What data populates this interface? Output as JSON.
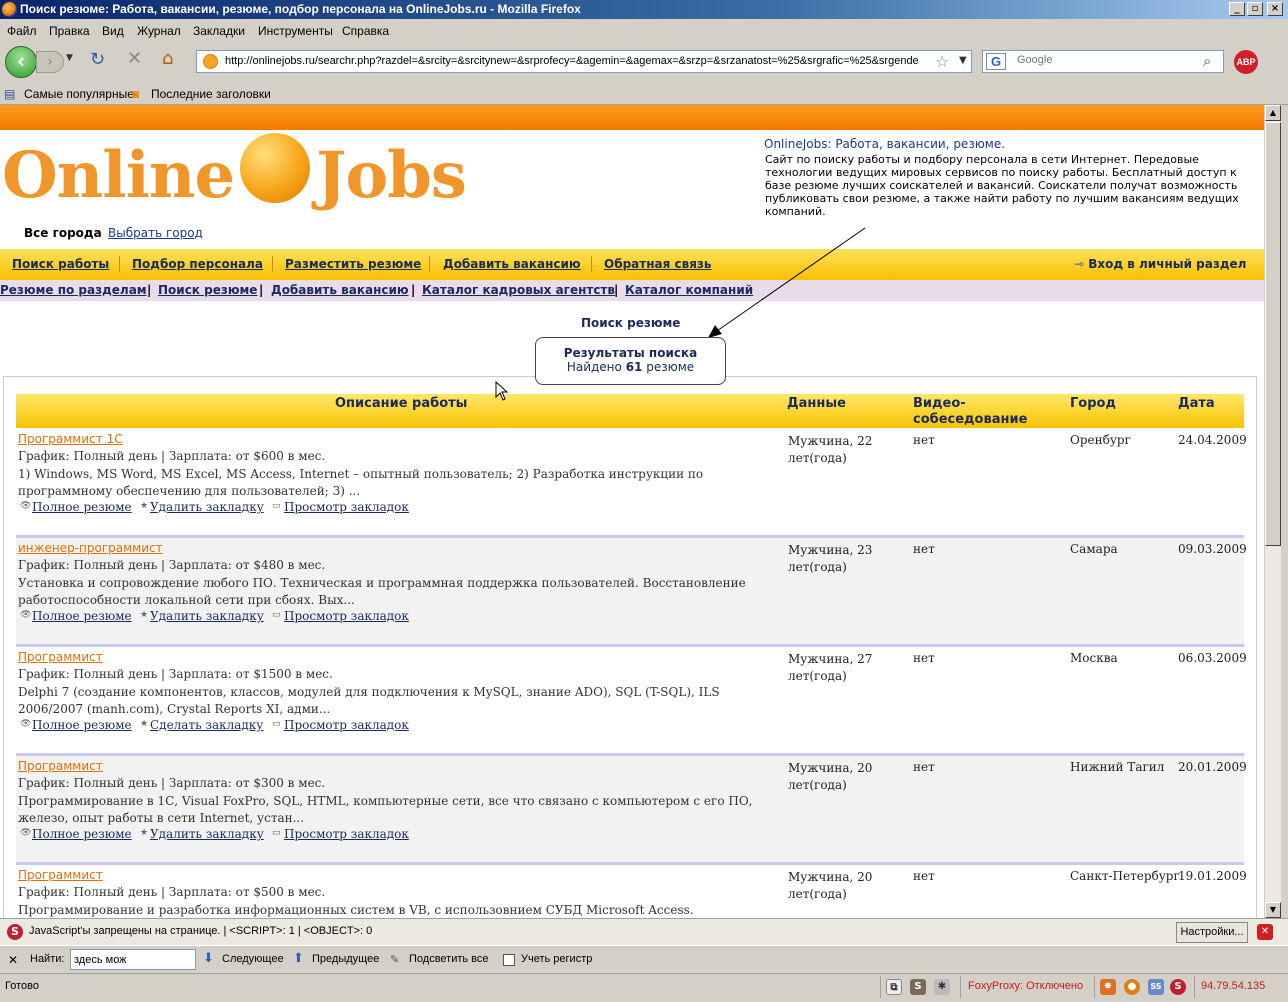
{
  "window": {
    "title": "Поиск резюме: Работа, вакансии, резюме, подбор персонала на OnlineJobs.ru - Mozilla Firefox"
  },
  "menu": [
    "Файл",
    "Правка",
    "Вид",
    "Журнал",
    "Закладки",
    "Инструменты",
    "Справка"
  ],
  "nav": {
    "url": "http://onlinejobs.ru/searchr.php?razdel=&srcity=&srcitynew=&srprofecy=&agemin=&agemax=&srzp=&srzanatost=%25&srgrafic=%25&srgende",
    "search_placeholder": "Google",
    "abp_label": "ABP"
  },
  "bookmarks": [
    "Самые популярные",
    "Последние заголовки"
  ],
  "page": {
    "logo_left": "Online",
    "logo_right": "Jobs",
    "about_title": "OnlineJobs: Работа, вакансии, резюме.",
    "about_text": "Сайт по поиску работы и подбору персонала в сети Интернет. Передовые технологии ведущих мировых сервисов по поиску работы. Бесплатный доступ к базе резюме лучших соискателей и вакансий. Соискатели получат возможность публиковать свои резюме, а также найти работу по лучшим вакансиям ведущих компаний.",
    "city_current": "Все города",
    "city_choose": "Выбрать город",
    "main_menu": [
      "Поиск работы",
      "Подбор персонала",
      "Разместить резюме",
      "Добавить вакансию",
      "Обратная связь"
    ],
    "login": "Вход в личный раздел",
    "sub_menu": [
      "Резюме по разделам",
      "Поиск резюме",
      "Добавить вакансию",
      "Каталог кадровых агентств",
      "Каталог компаний"
    ],
    "search_title": "Поиск резюме",
    "results_title": "Результаты поиска",
    "results_prefix": "Найдено",
    "results_count": "61",
    "results_suffix": "резюме",
    "columns": [
      "Описание работы",
      "Данные",
      "Видео-собеседование",
      "Город",
      "Дата"
    ],
    "rows": [
      {
        "title": "Программист 1С",
        "schedule": "График: Полный день | Зарплата: от $600 в мес.",
        "desc": "1) Windows, MS Word, MS Excel, MS Access, Internet – опытный пользователь; 2) Разработка инструкции по программному обеспечению для пользователей; 3) ...",
        "a1": "Полное резюме",
        "a2": "Удалить закладку",
        "a3": "Просмотр закладок",
        "person": "Мужчина, 22 лет(года)",
        "video": "нет",
        "city": "Оренбург",
        "date": "24.04.2009"
      },
      {
        "title": "инженер-программист",
        "schedule": "График: Полный день | Зарплата: от $480 в мес.",
        "desc": "Установка и сопровождение любого ПО. Техническая и программная поддержка пользователей. Восстановление работоспособности локальной сети при сбоях. Вых...",
        "a1": "Полное резюме",
        "a2": "Удалить закладку",
        "a3": "Просмотр закладок",
        "person": "Мужчина, 23 лет(года)",
        "video": "нет",
        "city": "Самара",
        "date": "09.03.2009"
      },
      {
        "title": "Программист",
        "schedule": "График: Полный день | Зарплата: от $1500 в мес.",
        "desc": "Delphi 7 (создание компонентов, классов, модулей для подключения к MySQL, знание ADO), SQL (T-SQL), ILS 2006/2007 (manh.com), Crystal Reports XI, адми...",
        "a1": "Полное резюме",
        "a2": "Сделать закладку",
        "a3": "Просмотр закладок",
        "person": "Мужчина, 27 лет(года)",
        "video": "нет",
        "city": "Москва",
        "date": "06.03.2009"
      },
      {
        "title": "Программист",
        "schedule": "График: Полный день | Зарплата: от $300 в мес.",
        "desc": "Программирование в 1С, Visual FoxPro, SQL, HTML, компьютерные сети, все что связано с компьютером с его ПО, железо, опыт работы в сети Internet, устан...",
        "a1": "Полное резюме",
        "a2": "Удалить закладку",
        "a3": "Просмотр закладок",
        "person": "Мужчина, 20 лет(года)",
        "video": "нет",
        "city": "Нижний Тагил",
        "date": "20.01.2009"
      },
      {
        "title": "Программист",
        "schedule": "График: Полный день | Зарплата: от $500 в мес.",
        "desc": "Программирование и разработка информационных систем в VB, с использовнием СУБД Microsoft Access.",
        "a1": "",
        "a2": "",
        "a3": "",
        "person": "Мужчина, 20 лет(года)",
        "video": "нет",
        "city": "Санкт-Петербург",
        "date": "19.01.2009"
      }
    ]
  },
  "noscript": {
    "message": "JavaScript'ы запрещены на странице. | <SCRIPT>: 1 | <OBJECT>: 0",
    "settings": "Настройки..."
  },
  "findbar": {
    "label": "Найти:",
    "value": "здесь мож",
    "next": "Следующее",
    "prev": "Предыдущее",
    "highlight": "Подсветить все",
    "matchcase": "Учеть регистр"
  },
  "status": {
    "ready": "Готово",
    "foxyproxy": "FoxyProxy: Отключено",
    "ip": "94.79.54.135"
  }
}
